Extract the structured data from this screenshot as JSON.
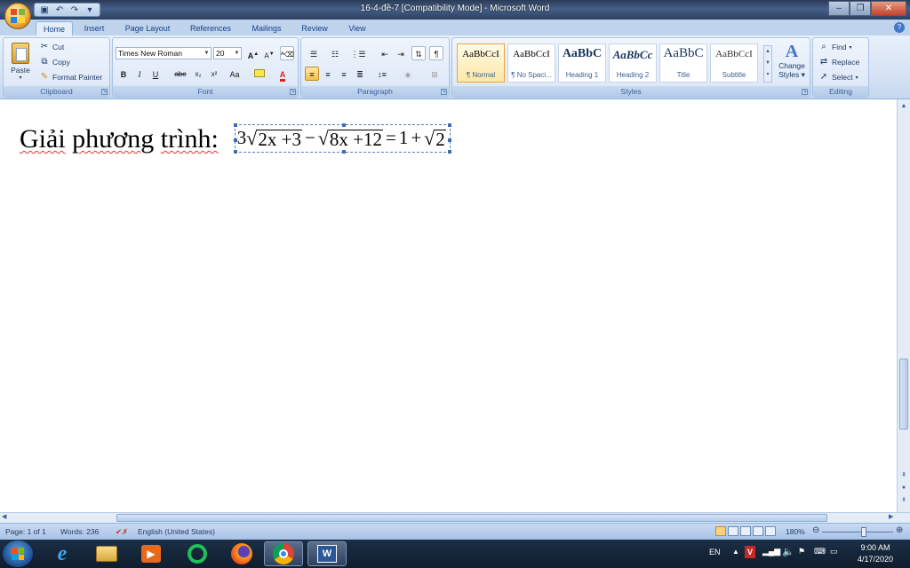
{
  "window": {
    "title": "16-4-đề-7 [Compatibility Mode] - Microsoft Word",
    "quick_access": [
      "save-icon",
      "undo-icon",
      "redo-icon",
      "customize-icon"
    ],
    "controls": [
      "minimize",
      "maximize",
      "close"
    ]
  },
  "tabs": [
    {
      "label": "Home",
      "active": true
    },
    {
      "label": "Insert"
    },
    {
      "label": "Page Layout"
    },
    {
      "label": "References"
    },
    {
      "label": "Mailings"
    },
    {
      "label": "Review"
    },
    {
      "label": "View"
    }
  ],
  "ribbon": {
    "clipboard": {
      "label": "Clipboard",
      "paste": "Paste",
      "cut": "Cut",
      "copy": "Copy",
      "format_painter": "Format Painter"
    },
    "font": {
      "label": "Font",
      "family": "Times New Roman",
      "size": "20",
      "grow": "A",
      "shrink": "A",
      "bold": "B",
      "italic": "I",
      "underline": "U",
      "strike": "abe",
      "subscript": "x₂",
      "superscript": "x²",
      "change_case": "Aa",
      "font_color": "A"
    },
    "paragraph": {
      "label": "Paragraph"
    },
    "styles": {
      "label": "Styles",
      "items": [
        {
          "sample": "AaBbCcI",
          "name": "¶ Normal",
          "selected": true
        },
        {
          "sample": "AaBbCcI",
          "name": "¶ No Spaci..."
        },
        {
          "sample": "AaBbC",
          "name": "Heading 1"
        },
        {
          "sample": "AaBbCc",
          "name": "Heading 2"
        },
        {
          "sample": "AaBbC",
          "name": "Title"
        },
        {
          "sample": "AaBbCcI",
          "name": "Subtitle"
        }
      ],
      "change_styles_line1": "Change",
      "change_styles_line2": "Styles"
    },
    "editing": {
      "label": "Editing",
      "find": "Find",
      "replace": "Replace",
      "select": "Select"
    }
  },
  "document": {
    "words": [
      "Giải",
      "phương",
      "trình:"
    ],
    "equation": {
      "coef": "3",
      "root1": "2x +3",
      "minus": "−",
      "root2": "8x +12",
      "equals": "=",
      "one": "1",
      "plus": "+",
      "root3": "2"
    }
  },
  "status": {
    "page": "Page: 1 of 1",
    "words": "Words: 236",
    "language": "English (United States)",
    "zoom": "180%"
  },
  "taskbar": {
    "apps": [
      "internet-explorer-icon",
      "file-explorer-icon",
      "media-player-icon",
      "opera-icon",
      "firefox-icon",
      "chrome-icon",
      "word-icon"
    ],
    "lang": "EN",
    "time": "9:00 AM",
    "date": "4/17/2020"
  },
  "colors": {
    "ribbon_bg": "#d3e1f3",
    "accent": "#15428b",
    "selected_style": "#fde7a4"
  }
}
